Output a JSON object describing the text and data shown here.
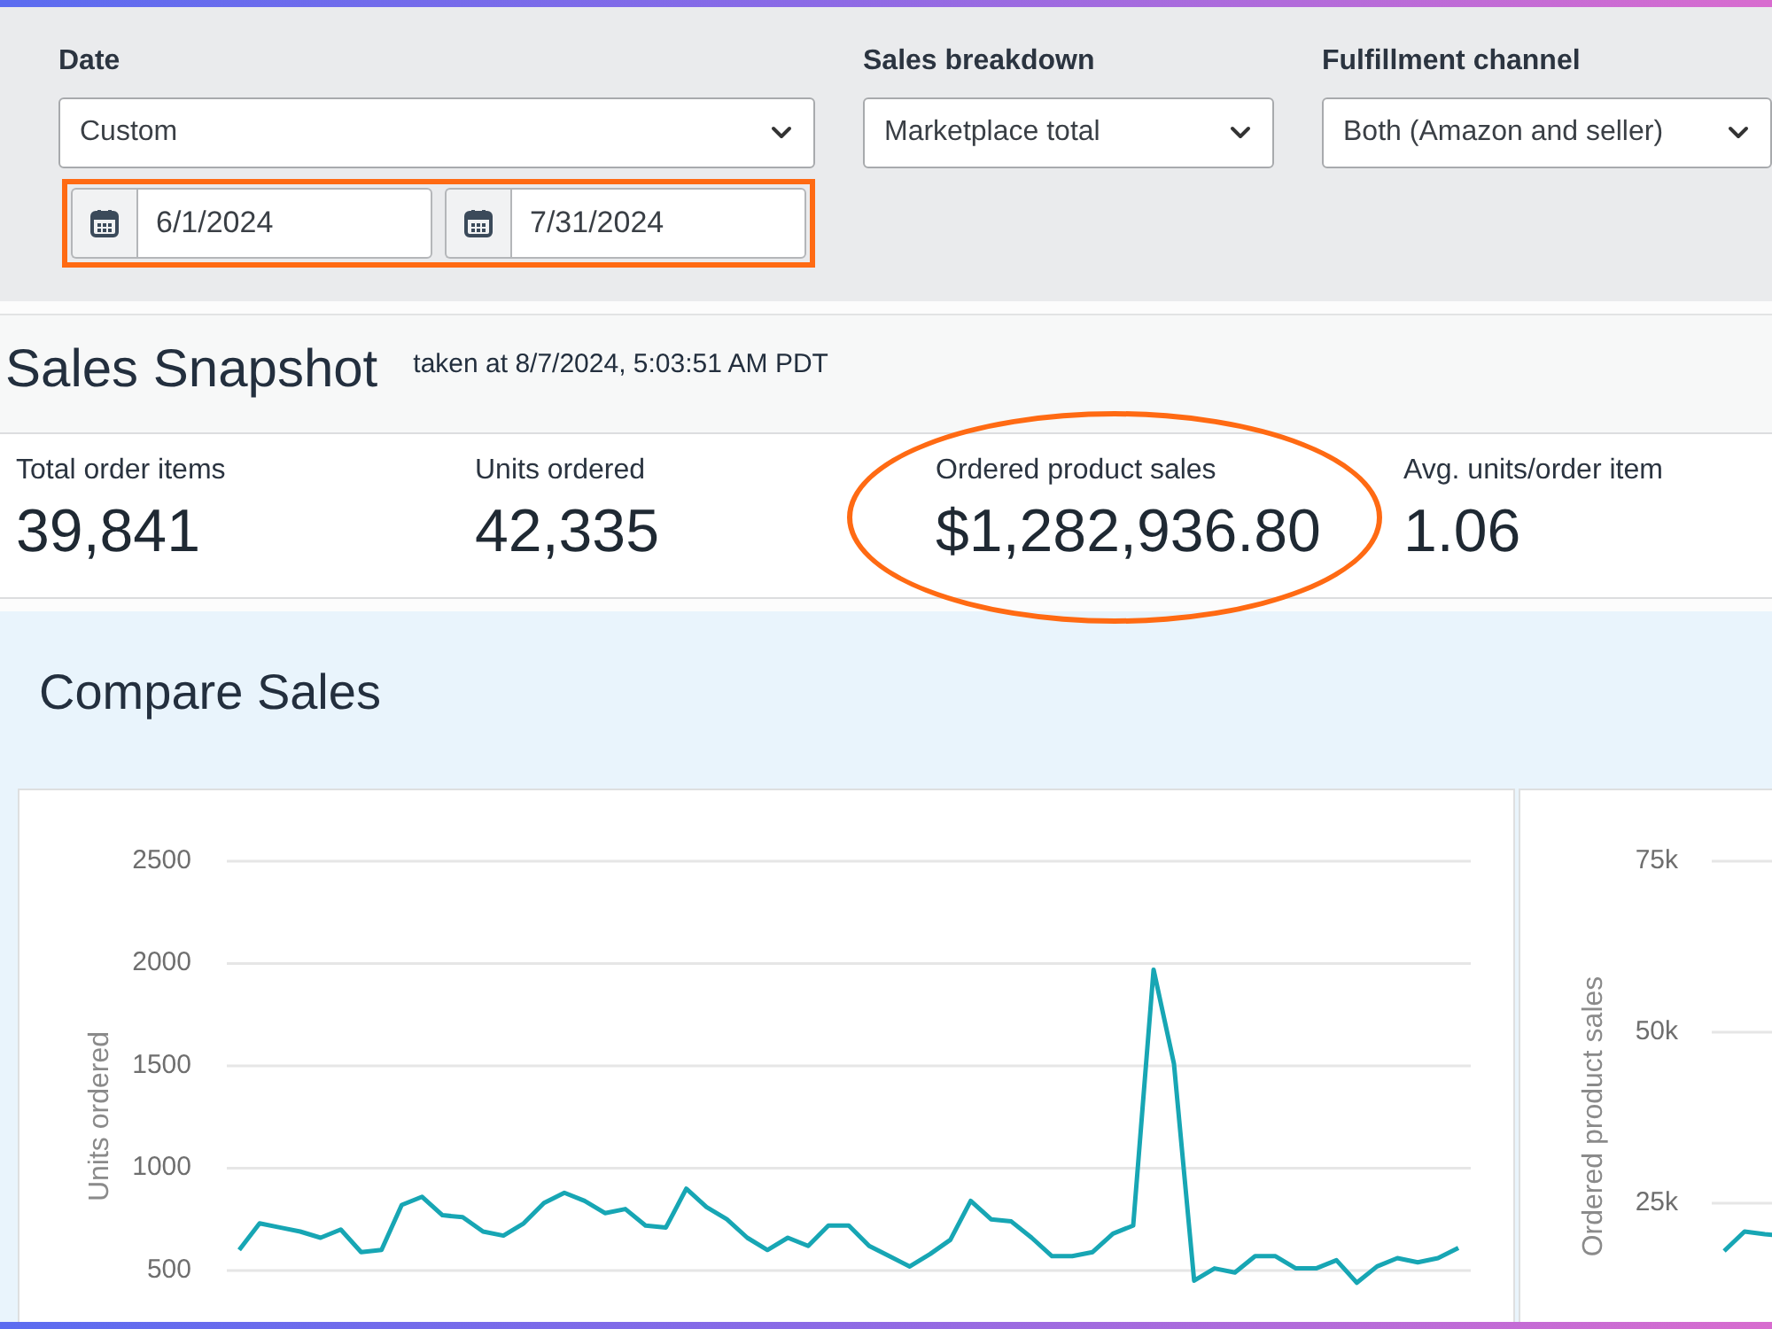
{
  "filters": [
    {
      "kind": "date",
      "label": "Date",
      "value": "Custom",
      "range": {
        "highlighted": true,
        "start": "6/1/2024",
        "end": "7/31/2024"
      }
    },
    {
      "kind": "select",
      "label": "Sales breakdown",
      "value": "Marketplace total"
    },
    {
      "kind": "select",
      "label": "Fulfillment channel",
      "value": "Both (Amazon and seller)"
    }
  ],
  "snapshot": {
    "title": "Sales Snapshot",
    "timestamp": "taken at 8/7/2024, 5:03:51 AM PDT",
    "metrics": [
      {
        "label": "Total order items",
        "value": "39,841",
        "highlighted": false
      },
      {
        "label": "Units ordered",
        "value": "42,335",
        "highlighted": false
      },
      {
        "label": "Ordered product sales",
        "value": "$1,282,936.80",
        "highlighted": true
      },
      {
        "label": "Avg. units/order item",
        "value": "1.06",
        "highlighted": false
      }
    ]
  },
  "compare_sales": {
    "title": "Compare Sales",
    "charts": [
      {
        "kind": "chart",
        "chart_data": {
          "type": "line",
          "ylabel": "Units ordered",
          "grid": true,
          "ylim": [
            240,
            2500
          ],
          "yticks": [
            500,
            1000,
            1500,
            2000,
            2500
          ],
          "categories": [
            null,
            null,
            null,
            null,
            null,
            null,
            null,
            null,
            null,
            null,
            null,
            null,
            null,
            null,
            null,
            null,
            null,
            null,
            null,
            null,
            null,
            null,
            null,
            null,
            null,
            null,
            null,
            null,
            null,
            null,
            null,
            null,
            null,
            null,
            null,
            null,
            null,
            null,
            null,
            null,
            null,
            null,
            null,
            null,
            null,
            null,
            null,
            null,
            null,
            null,
            null,
            null,
            null,
            null,
            null,
            null,
            null,
            null,
            null,
            null,
            null
          ],
          "values": [
            600,
            730,
            710,
            690,
            660,
            700,
            590,
            600,
            820,
            860,
            770,
            760,
            690,
            670,
            730,
            830,
            880,
            840,
            780,
            800,
            720,
            710,
            900,
            810,
            750,
            660,
            600,
            660,
            620,
            720,
            720,
            620,
            570,
            520,
            580,
            650,
            840,
            750,
            740,
            660,
            570,
            570,
            590,
            680,
            720,
            1970,
            1510,
            450,
            510,
            490,
            570,
            570,
            510,
            510,
            550,
            440,
            520,
            560,
            540,
            560,
            610
          ]
        }
      },
      {
        "kind": "picture",
        "ylabel": "Ordered product sales",
        "tick_labels": [
          "75k",
          "50k",
          "25k"
        ]
      }
    ]
  }
}
